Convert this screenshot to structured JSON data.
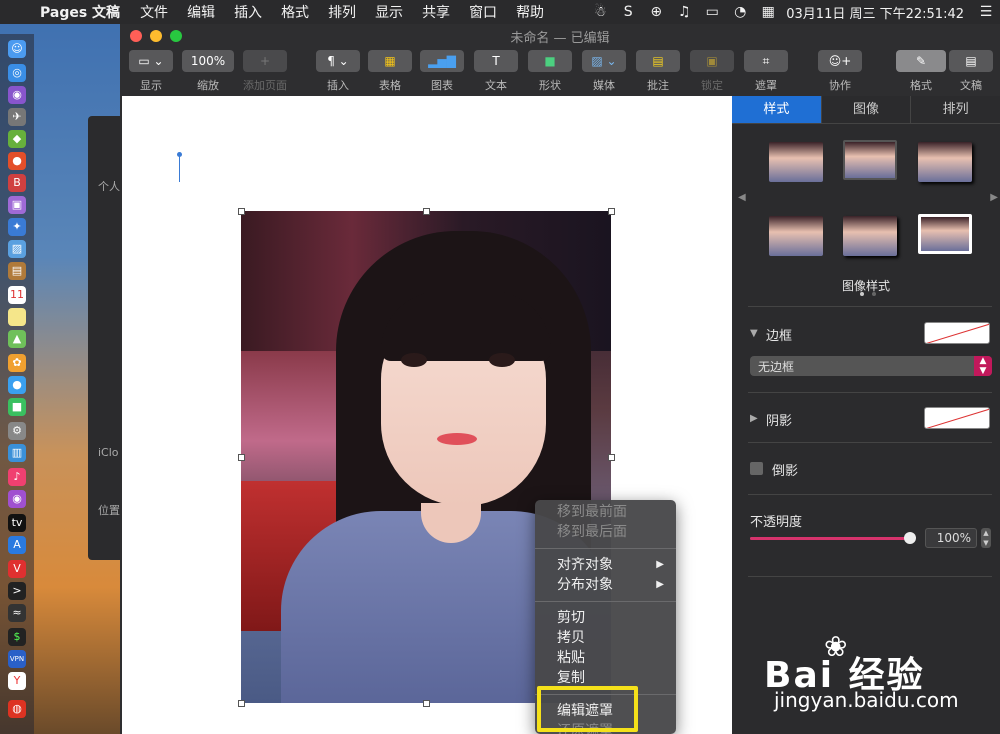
{
  "menubar": {
    "app_name": "Pages 文稿",
    "items": [
      "文件",
      "编辑",
      "插入",
      "格式",
      "排列",
      "显示",
      "共享",
      "窗口",
      "帮助"
    ],
    "clock": "03月11日 周三 下午22:51:42"
  },
  "window": {
    "title": "未命名 — 已编辑"
  },
  "toolbar": {
    "view_label": "显示",
    "zoom_value": "100%",
    "zoom_label": "缩放",
    "add_page_label": "添加页面",
    "insert_label": "插入",
    "table_label": "表格",
    "chart_label": "图表",
    "text_label": "文本",
    "shape_label": "形状",
    "media_label": "媒体",
    "comment_label": "批注",
    "lock_label": "锁定",
    "mask_label": "遮罩",
    "collab_label": "协作",
    "format_label": "格式",
    "document_label": "文稿"
  },
  "context_menu": {
    "items": [
      {
        "label": "移到最前面",
        "enabled": false
      },
      {
        "label": "移到最后面",
        "enabled": false
      },
      {
        "label": "对齐对象",
        "enabled": true,
        "submenu": true
      },
      {
        "label": "分布对象",
        "enabled": true,
        "submenu": true
      },
      {
        "label": "剪切",
        "enabled": true
      },
      {
        "label": "拷贝",
        "enabled": true
      },
      {
        "label": "粘贴",
        "enabled": true
      },
      {
        "label": "复制",
        "enabled": true
      },
      {
        "label": "编辑遮罩",
        "enabled": true
      },
      {
        "label": "还原遮罩",
        "enabled": false
      }
    ],
    "highlight_color": "#f5e11a"
  },
  "sidebar": {
    "tabs": [
      "样式",
      "图像",
      "排列"
    ],
    "active_tab": "样式",
    "image_styles_label": "图像样式",
    "border_label": "边框",
    "border_value": "无边框",
    "shadow_label": "阴影",
    "reflection_label": "倒影",
    "opacity_label": "不透明度",
    "opacity_value": "100%",
    "opacity_level": 1.0
  },
  "background_window": {
    "labels": [
      "个人",
      "iClo",
      "位置"
    ]
  },
  "watermark": {
    "logo": "Bai 经验",
    "url": "jingyan.baidu.com"
  },
  "colors": {
    "accent": "#1f6fd4",
    "slider": "#d6336c",
    "select": "#c2185b"
  }
}
